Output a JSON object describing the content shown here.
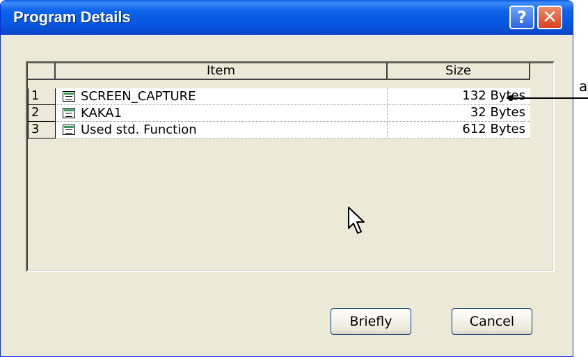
{
  "window": {
    "title": "Program Details",
    "help_label": "?",
    "close_label": "✕"
  },
  "table": {
    "columns": {
      "num": "",
      "item": "Item",
      "size": "Size"
    },
    "rows": [
      {
        "num": "1",
        "item": "SCREEN_CAPTURE",
        "size": "132 Bytes",
        "icon": "program-block-icon"
      },
      {
        "num": "2",
        "item": "KAKA1",
        "size": "32 Bytes",
        "icon": "program-block-icon"
      },
      {
        "num": "3",
        "item": "Used std. Function",
        "size": "612 Bytes",
        "icon": "program-block-icon"
      }
    ]
  },
  "buttons": {
    "briefly": "Briefly",
    "cancel": "Cancel"
  },
  "callout": {
    "label": "a"
  }
}
